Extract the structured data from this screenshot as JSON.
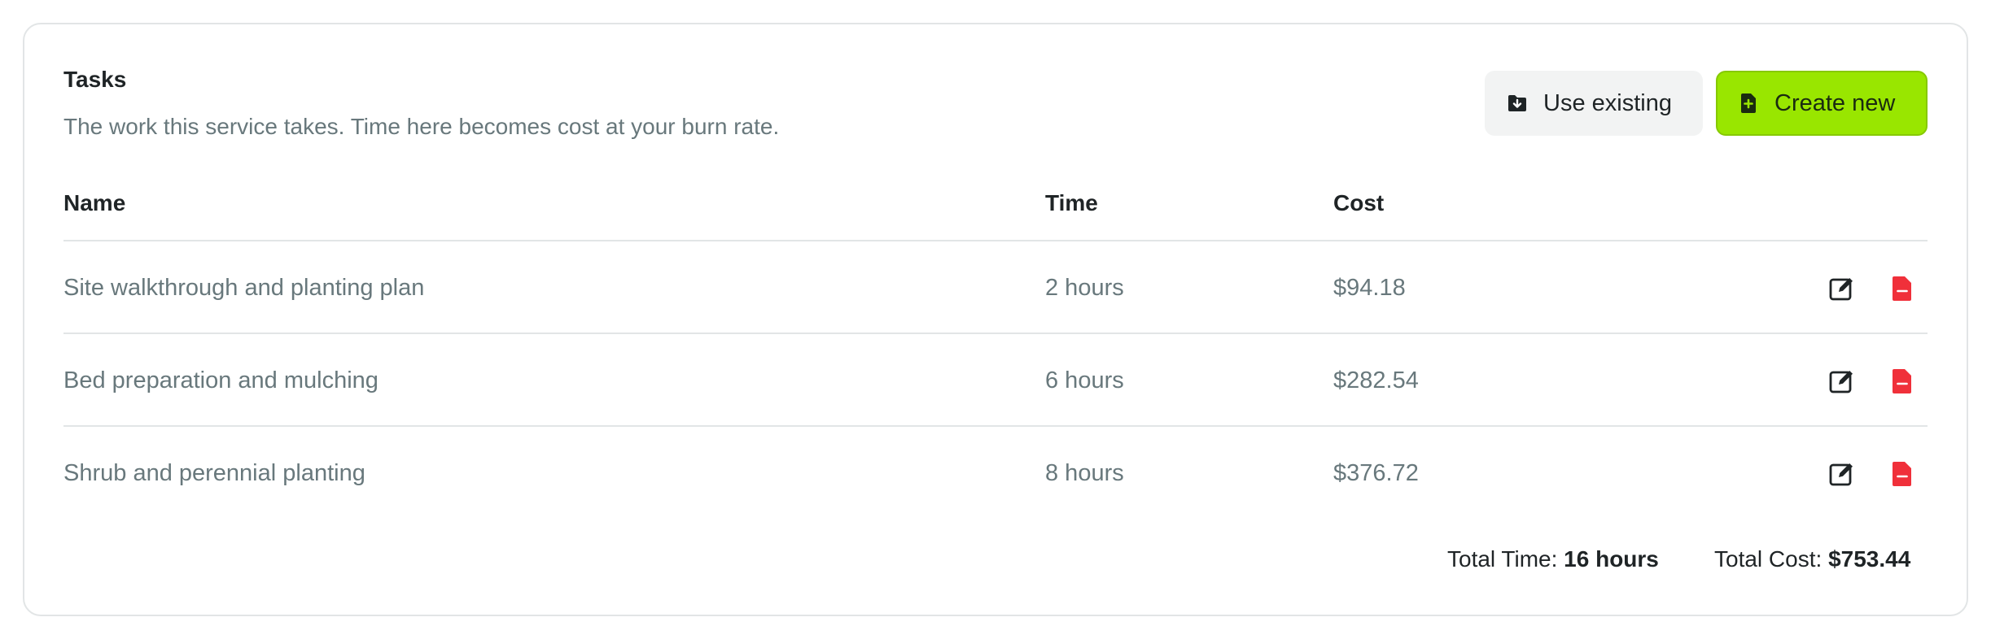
{
  "section": {
    "title": "Tasks",
    "subtitle": "The work this service takes. Time here becomes cost at your burn rate."
  },
  "buttons": {
    "use_existing": "Use existing",
    "create_new": "Create new"
  },
  "table": {
    "headers": {
      "name": "Name",
      "time": "Time",
      "cost": "Cost"
    },
    "rows": [
      {
        "name": "Site walkthrough and planting plan",
        "time": "2 hours",
        "cost": "$94.18"
      },
      {
        "name": "Bed preparation and mulching",
        "time": "6 hours",
        "cost": "$282.54"
      },
      {
        "name": "Shrub and perennial planting",
        "time": "8 hours",
        "cost": "$376.72"
      }
    ]
  },
  "totals": {
    "time_label": "Total Time:",
    "time_value": "16 hours",
    "cost_label": "Total Cost:",
    "cost_value": "$753.44"
  },
  "icons": {
    "use_existing": "folder-download-icon",
    "create_new": "file-plus-icon",
    "edit": "edit-icon",
    "delete": "file-minus-icon"
  },
  "colors": {
    "accent": "#99e600",
    "delete": "#f0303a",
    "muted_text": "#68787c"
  }
}
